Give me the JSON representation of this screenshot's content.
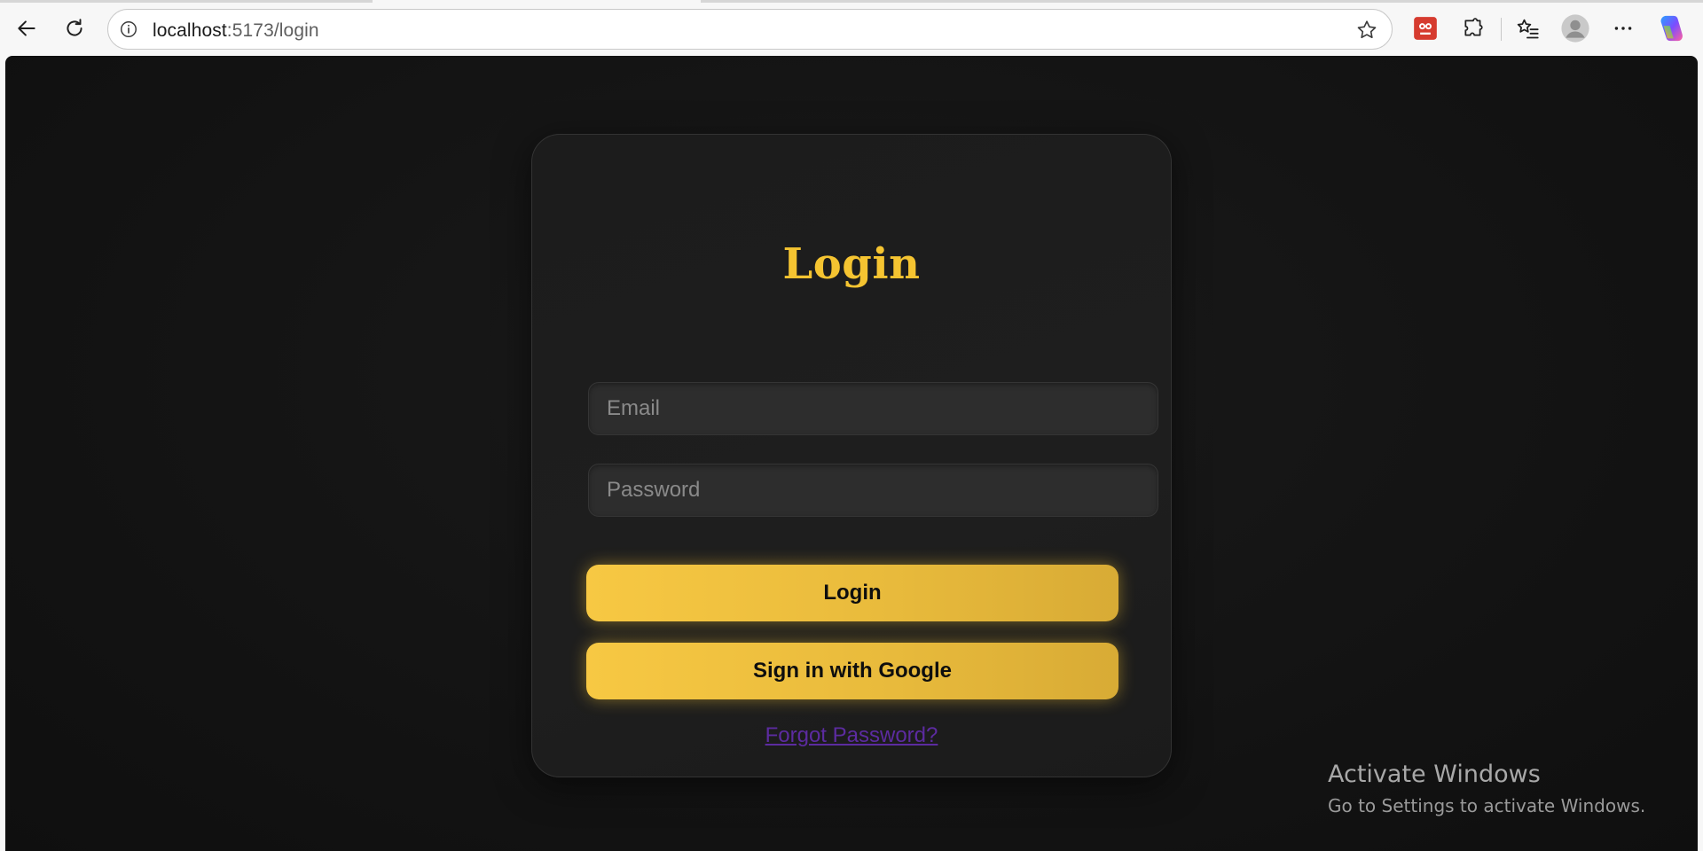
{
  "browser": {
    "url_host": "localhost",
    "url_path": ":5173/login"
  },
  "login_card": {
    "title": "Login",
    "email_placeholder": "Email",
    "password_placeholder": "Password",
    "login_button": "Login",
    "google_button": "Sign in with Google",
    "forgot_link": "Forgot Password?"
  },
  "os_watermark": {
    "title": "Activate Windows",
    "subtitle": "Go to Settings to activate Windows."
  },
  "colors": {
    "accent_gold": "#f5c431",
    "link_purple": "#5c2ba0",
    "page_bg": "#121212",
    "card_bg": "#1d1d1d"
  }
}
